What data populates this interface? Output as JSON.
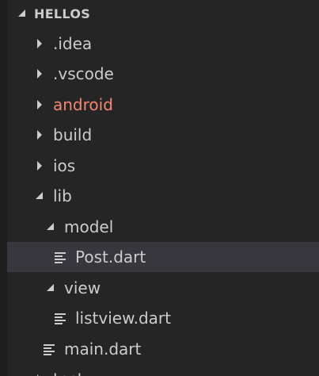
{
  "explorer": {
    "section_title": "HELLOS",
    "items": [
      {
        "label": ".idea",
        "type": "folder",
        "expanded": false,
        "depth": 0
      },
      {
        "label": ".vscode",
        "type": "folder",
        "expanded": false,
        "depth": 0
      },
      {
        "label": "android",
        "type": "folder",
        "expanded": false,
        "depth": 0,
        "status": "modified",
        "color": "#f48771"
      },
      {
        "label": "build",
        "type": "folder",
        "expanded": false,
        "depth": 0
      },
      {
        "label": "ios",
        "type": "folder",
        "expanded": false,
        "depth": 0
      },
      {
        "label": "lib",
        "type": "folder",
        "expanded": true,
        "depth": 0
      },
      {
        "label": "model",
        "type": "folder",
        "expanded": true,
        "depth": 1
      },
      {
        "label": "Post.dart",
        "type": "file",
        "depth": 2,
        "selected": true
      },
      {
        "label": "view",
        "type": "folder",
        "expanded": true,
        "depth": 1
      },
      {
        "label": "listview.dart",
        "type": "file",
        "depth": 2
      },
      {
        "label": "main.dart",
        "type": "file",
        "depth": 1
      },
      {
        "label": "test",
        "type": "folder",
        "expanded": false,
        "depth": 0
      }
    ]
  },
  "colors": {
    "background": "#252526",
    "selected_row": "#37373d",
    "text": "#cccccc",
    "modified": "#f48771"
  }
}
